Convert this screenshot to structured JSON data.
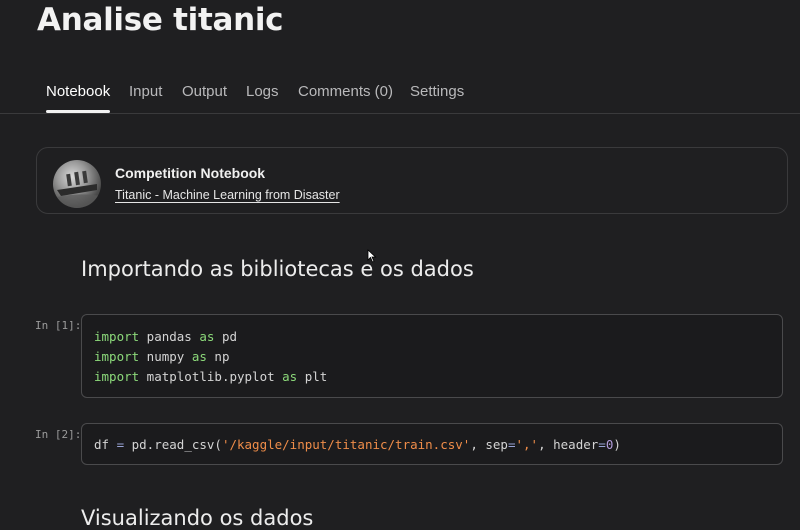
{
  "page": {
    "title": "Analise titanic"
  },
  "tabs": [
    {
      "label": "Notebook",
      "active": true
    },
    {
      "label": "Input"
    },
    {
      "label": "Output"
    },
    {
      "label": "Logs"
    },
    {
      "label": "Comments (0)"
    },
    {
      "label": "Settings"
    }
  ],
  "competition": {
    "heading": "Competition Notebook",
    "link": "Titanic - Machine Learning from Disaster",
    "avatar_icon": "titanic-ship-image"
  },
  "sections": {
    "import_heading": "Importando as bibliotecas e os dados",
    "visual_heading": "Visualizando os dados"
  },
  "cells": [
    {
      "prompt": "In [1]:",
      "lines": [
        [
          "import",
          " pandas ",
          "as",
          " pd"
        ],
        [
          "import",
          " numpy ",
          "as",
          " np"
        ],
        [
          "import",
          " matplotlib.pyplot ",
          "as",
          " plt"
        ]
      ]
    },
    {
      "prompt": "In [2]:",
      "tokens": {
        "a": "df ",
        "b": "=",
        "c": " pd.read_csv(",
        "d": "'/kaggle/input/titanic/train.csv'",
        "e": ", sep",
        "f": "=",
        "g": "','",
        "h": ", header",
        "i": "=",
        "j": "0",
        "k": ")"
      }
    }
  ],
  "colors": {
    "background": "#1f1f21",
    "keyword": "#8cd97a",
    "string": "#f08d49",
    "number": "#b39ddb",
    "operator": "#9aa4d6"
  }
}
